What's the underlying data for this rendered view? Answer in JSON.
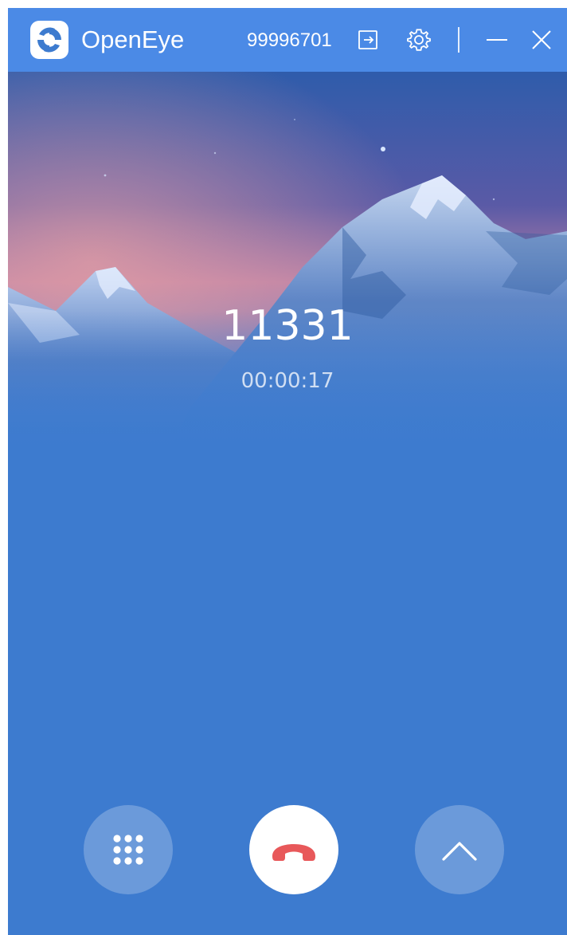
{
  "titlebar": {
    "app_name": "OpenEye",
    "account_number": "99996701",
    "icons": [
      "logo-icon",
      "logout-icon",
      "gear-icon",
      "minimize-icon",
      "close-icon"
    ]
  },
  "call": {
    "number": "11331",
    "duration": "00:00:17"
  },
  "controls": {
    "icons": [
      "dialpad-icon",
      "hang-up-icon",
      "chevron-up-icon"
    ],
    "hangup_color": "#e8585a"
  },
  "colors": {
    "titlebar_bg": "#4b8ae6",
    "window_bg": "#3d7bcf",
    "accent": "#ffffff"
  }
}
